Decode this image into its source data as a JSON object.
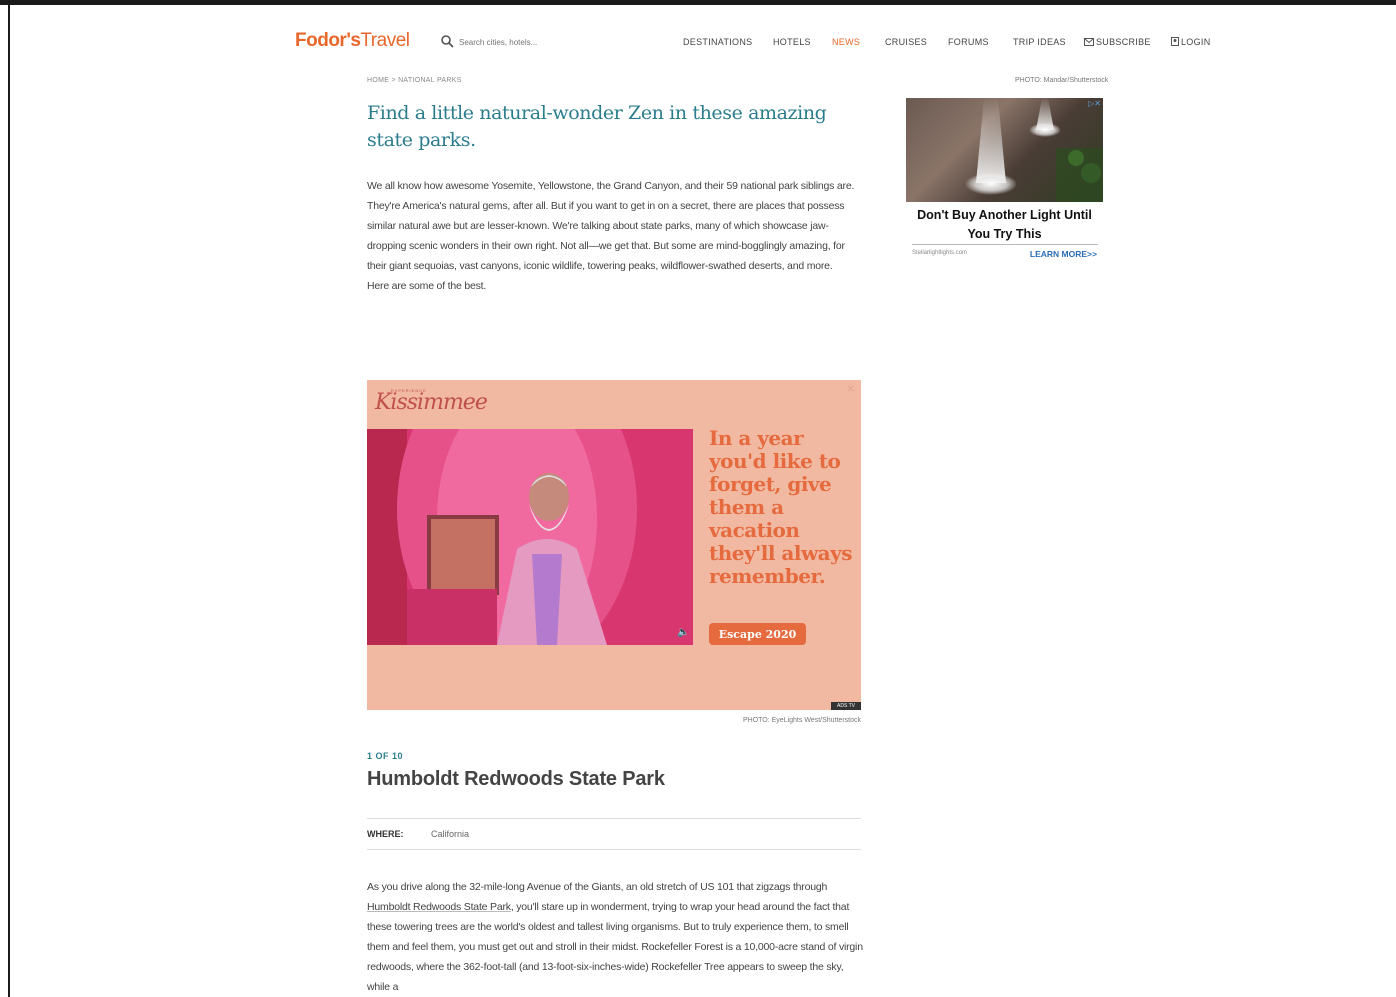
{
  "header": {
    "logo_bold": "Fodor's",
    "logo_light": "Travel",
    "search_placeholder": "Search cities, hotels...",
    "nav": [
      "DESTINATIONS",
      "HOTELS",
      "NEWS",
      "CRUISES",
      "FORUMS",
      "TRIP IDEAS"
    ],
    "active_nav": "NEWS",
    "subscribe": "SUBSCRIBE",
    "login": "LOGIN",
    "accent_color": "#e8672b"
  },
  "breadcrumb": "HOME > NATIONAL PARKS",
  "photo_credit_top": "PHOTO: Mandar/Shutterstock",
  "article": {
    "headline": "Find a little natural-wonder Zen in these amazing state parks.",
    "intro": "We all know how awesome Yosemite, Yellowstone, the Grand Canyon, and their 59 national park siblings are. They're America's natural gems, after all. But if you want to get in on a secret, there are places that possess similar natural awe but are lesser-known. We're talking about state parks, many of which showcase jaw-dropping scenic wonders in their own right. Not all—we get that. But some are mind-bogglingly amazing, for their giant sequoias, vast canyons, iconic wildlife, towering peaks, wildflower-swathed deserts, and more. Here are some of the best.",
    "headline_color": "#2b7d8e"
  },
  "side_ad": {
    "close_label": "▷✕",
    "headline": "Don't Buy Another Light Until You Try This",
    "domain": "Stellarlightlights.com",
    "cta": "LEARN MORE>>"
  },
  "video_ad": {
    "brand": "Kissimmee",
    "brand_sub": "EXPERIENCE",
    "copy": "In a year you'd like to forget, give them a vacation they'll always remember.",
    "button": "Escape 2020",
    "speaker_icon": "speaker-icon",
    "tag": "ADS TV"
  },
  "photo_credit": "PHOTO: EyeLights West/Shutterstock",
  "slide": {
    "count": "1 OF 10",
    "title": "Humboldt Redwoods State Park",
    "where_label": "WHERE:",
    "where_value": "California",
    "body_1": "As you drive along the 32-mile-long Avenue of the Giants, an old stretch of US 101 that zigzags through ",
    "body_link": "Humboldt Redwoods State Park",
    "body_2": ", you'll stare up in wonderment, trying to wrap your head around the fact that these towering trees are the world's oldest and tallest living organisms. But to truly experience them, to smell them and feel them, you must get out and stroll in their midst. Rockefeller Forest is a 10,000-acre stand of virgin redwoods, where the 362-foot-tall (and 13-foot-six-inches-wide) Rockefeller Tree appears to sweep the sky, while a"
  }
}
